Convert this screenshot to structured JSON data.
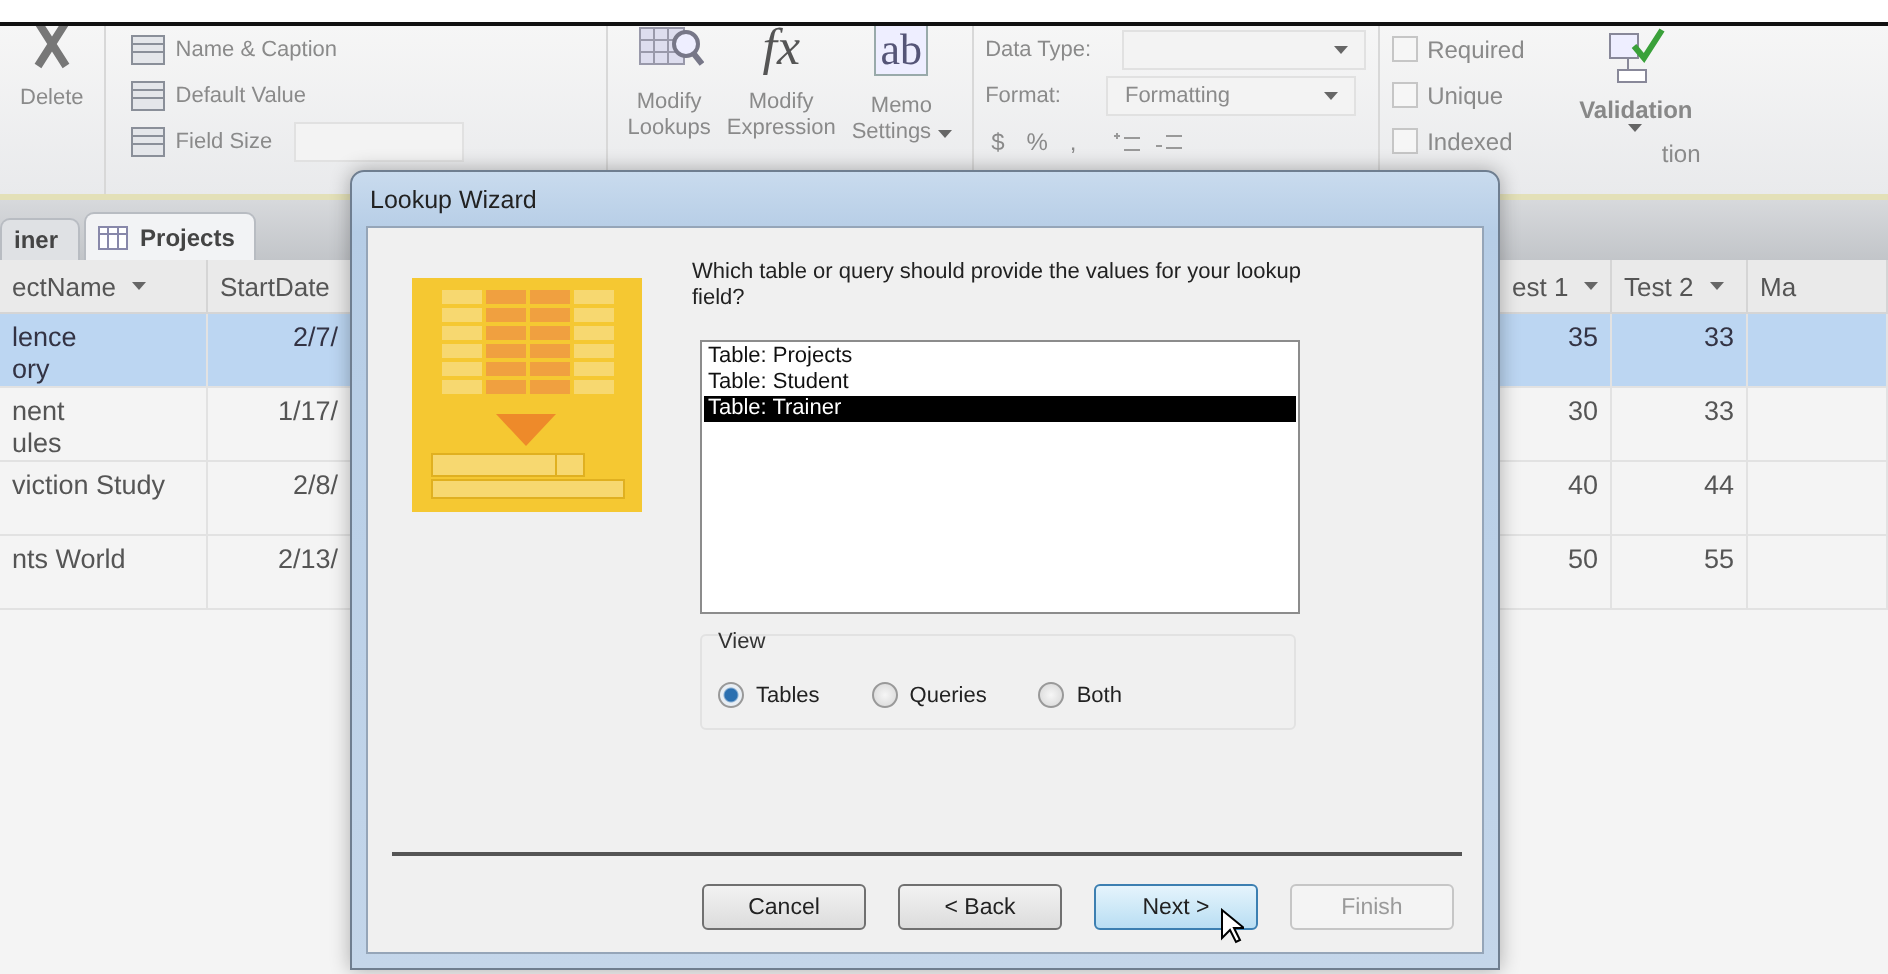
{
  "ribbon": {
    "delete_button": "Delete",
    "properties": [
      {
        "label": "Name & Caption",
        "has_field": false
      },
      {
        "label": "Default Value",
        "has_field": false
      },
      {
        "label": "Field Size",
        "has_field": true
      }
    ],
    "tools": [
      {
        "kind": "lookups",
        "lines": [
          "Modify",
          "Lookups"
        ],
        "dropdown": false
      },
      {
        "kind": "function",
        "glyph": "fx",
        "lines": [
          "Modify",
          "Expression"
        ],
        "dropdown": false
      },
      {
        "kind": "textbox",
        "glyph": "ab",
        "lines": [
          "Memo",
          "Settings"
        ],
        "dropdown": true
      }
    ],
    "data_type_label": "Data Type:",
    "format_label": "Format:",
    "format_value": "Formatting",
    "symbols": [
      "$",
      "%",
      ","
    ],
    "checks": [
      {
        "label": "Required",
        "checked": false
      },
      {
        "label": "Unique",
        "checked": false
      },
      {
        "label": "Indexed",
        "checked": false
      }
    ],
    "validation_button": "Validation",
    "group_label": "tion"
  },
  "tabs": [
    {
      "label": "iner",
      "selected": false
    },
    {
      "label": "Projects",
      "selected": true
    }
  ],
  "table": {
    "columns": [
      {
        "label": "ectName",
        "filter": true
      },
      {
        "label": "StartDate",
        "filter": false
      },
      {
        "label": "est 1",
        "filter": true
      },
      {
        "label": "Test 2",
        "filter": true
      },
      {
        "label": "Ma",
        "filter": false
      }
    ],
    "rows": [
      {
        "selected": true,
        "name": [
          "lence",
          "ory"
        ],
        "start": "2/7/",
        "test1": "35",
        "test2": "33"
      },
      {
        "selected": false,
        "name": [
          "nent",
          "ules"
        ],
        "start": "1/17/",
        "test1": "30",
        "test2": "33"
      },
      {
        "selected": false,
        "name": [
          "viction Study"
        ],
        "start": "2/8/",
        "test1": "40",
        "test2": "44"
      },
      {
        "selected": false,
        "name": [
          "nts World"
        ],
        "start": "2/13/",
        "test1": "50",
        "test2": "55"
      }
    ]
  },
  "dialog": {
    "title": "Lookup Wizard",
    "prompt": "Which table or query should provide the values for your lookup field?",
    "list": [
      {
        "label": "Table: Projects",
        "selected": false
      },
      {
        "label": "Table: Student",
        "selected": false
      },
      {
        "label": "Table: Trainer",
        "selected": true
      }
    ],
    "view_label": "View",
    "view_options": [
      {
        "label": "Tables",
        "selected": true
      },
      {
        "label": "Queries",
        "selected": false
      },
      {
        "label": "Both",
        "selected": false
      }
    ],
    "buttons": [
      {
        "label": "Cancel",
        "disabled": false,
        "hovered": false
      },
      {
        "label": "< Back",
        "disabled": false,
        "hovered": false
      },
      {
        "label": "Next >",
        "disabled": false,
        "hovered": true
      },
      {
        "label": "Finish",
        "disabled": true,
        "hovered": false
      }
    ]
  }
}
